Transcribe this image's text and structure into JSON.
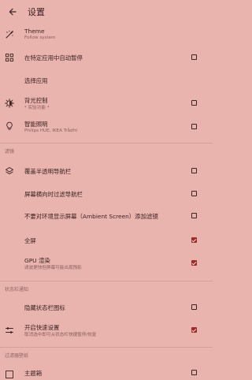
{
  "header": {
    "title": "设置"
  },
  "rows": [
    {
      "label": "Theme",
      "sub": "Follow system"
    },
    {
      "label": "在特定应用中自动暂停"
    },
    {
      "label": "选择应用"
    },
    {
      "label": "背光控制",
      "sub": "* 实验功能 *"
    },
    {
      "label": "智能照明",
      "sub": "Philips HUE, IKEA Trådfri"
    },
    {
      "label": "覆盖半透明导航栏"
    },
    {
      "label": "屏幕横向时过滤导航栏"
    },
    {
      "label": "不要对环境显示屏幕（Ambient Screen）添加滤镜"
    },
    {
      "label": "全屏"
    },
    {
      "label": "GPU 渲染",
      "sub": "滤波更快但屏幕可能出现残影"
    },
    {
      "label": "隐藏状态栏图标"
    },
    {
      "label": "开启快速设置",
      "sub": "取消选中即可从状态栏快捷暂停/恢复"
    },
    {
      "label": "主题箱"
    }
  ],
  "sections": {
    "filter": "滤镜",
    "status_notify": "状态栏通知",
    "filter_wallpaper": "过滤器壁纸"
  },
  "checkboxes": {
    "auto_pause": false,
    "backlight": false,
    "smart_light": false,
    "overlay_nav": false,
    "landscape_nav": false,
    "ambient": false,
    "fullscreen": true,
    "gpu": true,
    "hide_status_icon": false,
    "quick_settings": true,
    "theme_box": false
  },
  "colors": {
    "background": "#e9b3ae",
    "accent": "#9e2b2a",
    "text": "#3a2423"
  },
  "icons": [
    "back-arrow-icon",
    "theme-icon",
    "apps-grid-icon",
    "backlight-icon",
    "lightbulb-icon",
    "layers-icon",
    "sliders-icon",
    "wallpaper-icon"
  ]
}
